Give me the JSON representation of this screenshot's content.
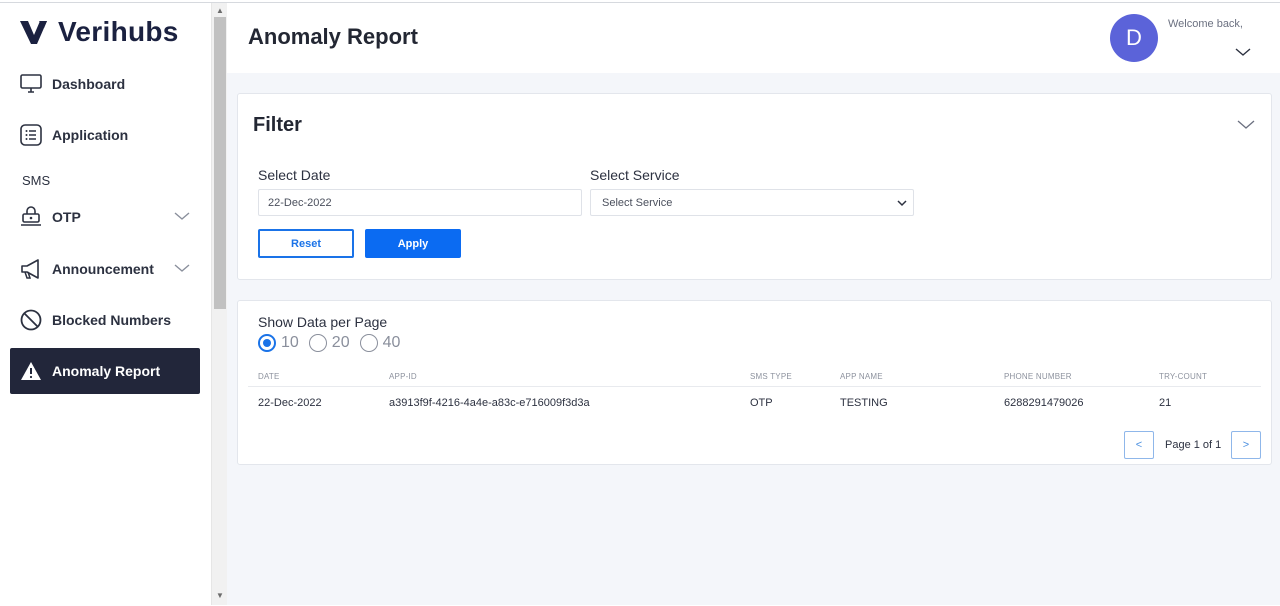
{
  "brand": {
    "name": "Verihubs"
  },
  "sidebar": {
    "items": [
      {
        "label": "Dashboard",
        "icon": "monitor-icon"
      },
      {
        "label": "Application",
        "icon": "list-icon"
      },
      {
        "label": "OTP",
        "icon": "otp-icon"
      },
      {
        "label": "Announcement",
        "icon": "megaphone-icon"
      },
      {
        "label": "Blocked Numbers",
        "icon": "blocked-icon"
      },
      {
        "label": "Anomaly Report",
        "icon": "warning-icon"
      }
    ],
    "section": "SMS",
    "active": "Anomaly Report"
  },
  "header": {
    "title": "Anomaly Report",
    "avatar_initial": "D",
    "welcome": "Welcome back,"
  },
  "filter": {
    "title": "Filter",
    "date_label": "Select Date",
    "date_value": "22-Dec-2022",
    "service_label": "Select Service",
    "service_value": "Select Service",
    "reset_label": "Reset",
    "apply_label": "Apply"
  },
  "table": {
    "perpage_label": "Show Data per Page",
    "perpage_options": [
      "10",
      "20",
      "40"
    ],
    "perpage_selected": "10",
    "columns": [
      "DATE",
      "APP-ID",
      "SMS TYPE",
      "APP NAME",
      "PHONE NUMBER",
      "TRY-COUNT"
    ],
    "rows": [
      [
        "22-Dec-2022",
        "a3913f9f-4216-4a4e-a83c-e716009f3d3a",
        "OTP",
        "TESTING",
        "6288291479026",
        "21"
      ]
    ],
    "pager": {
      "prev": "<",
      "next": ">",
      "text": "Page 1 of 1"
    }
  },
  "colors": {
    "accent": "#0b6bf2",
    "sidebar_active": "#22263a",
    "avatar": "#5b63d9"
  }
}
